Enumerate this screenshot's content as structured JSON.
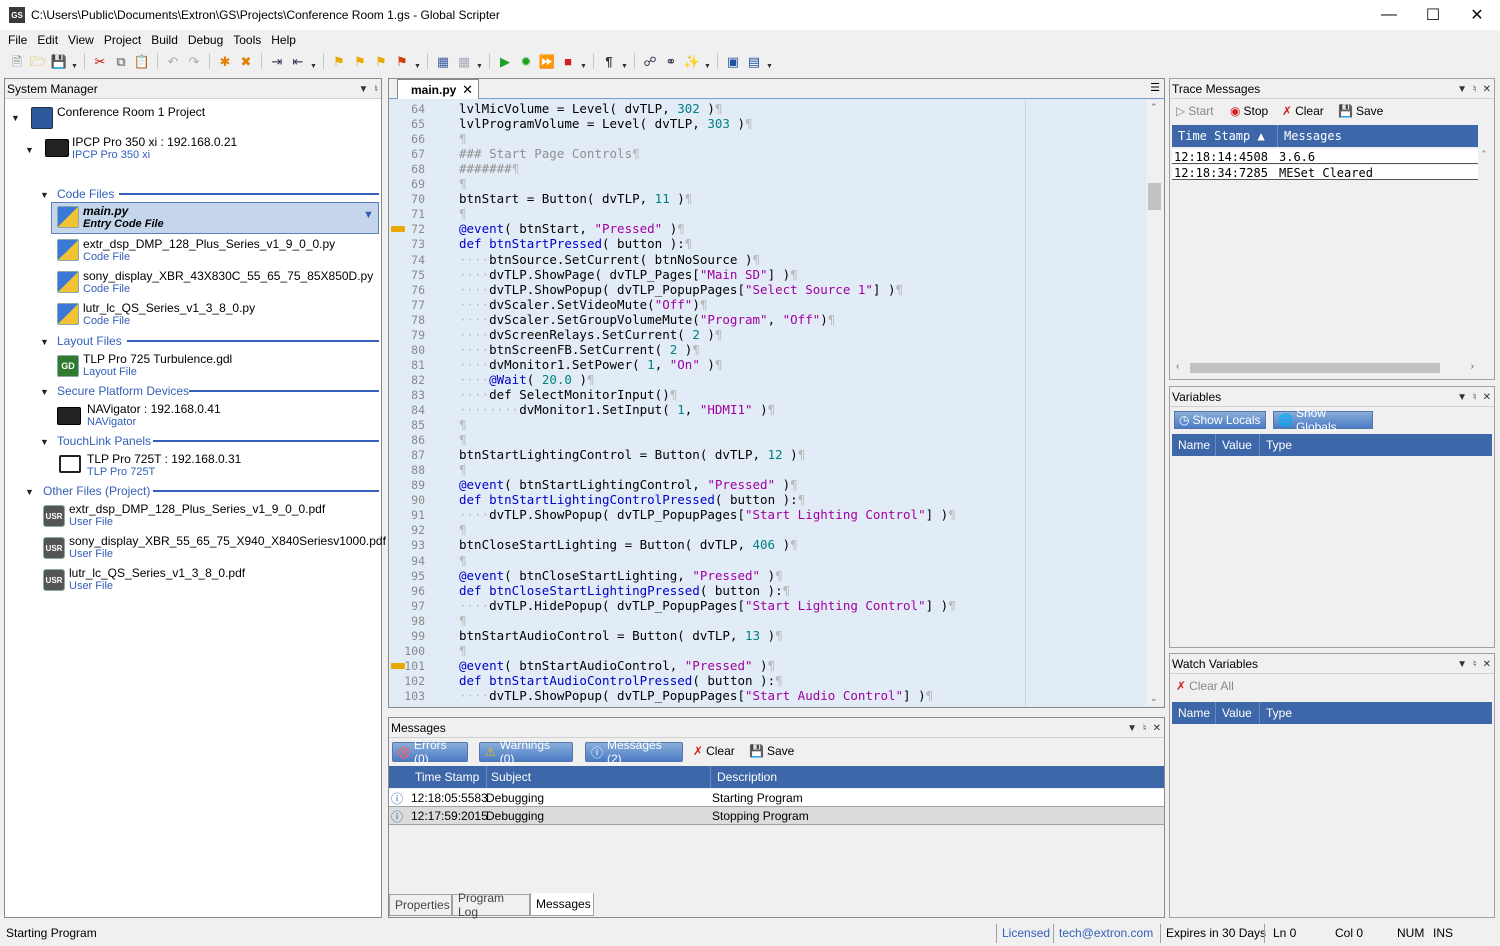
{
  "window": {
    "app_icon": "GS",
    "title": "C:\\Users\\Public\\Documents\\Extron\\GS\\Projects\\Conference Room 1.gs - Global Scripter"
  },
  "menu": [
    "File",
    "Edit",
    "View",
    "Project",
    "Build",
    "Debug",
    "Tools",
    "Help"
  ],
  "system_manager": {
    "title": "System Manager",
    "project": "Conference Room 1 Project",
    "controller": {
      "name": "IPCP Pro 350 xi : 192.168.0.21",
      "sub": "IPCP Pro 350 xi"
    },
    "sections": {
      "code_files": "Code Files",
      "layout_files": "Layout Files",
      "secure_platform": "Secure Platform Devices",
      "touchlink": "TouchLink Panels",
      "other_files": "Other Files (Project)"
    },
    "code_files": [
      {
        "name": "main.py",
        "sub": "Entry Code File"
      },
      {
        "name": "extr_dsp_DMP_128_Plus_Series_v1_9_0_0.py",
        "sub": "Code File"
      },
      {
        "name": "sony_display_XBR_43X830C_55_65_75_85X850D.py",
        "sub": "Code File"
      },
      {
        "name": "lutr_lc_QS_Series_v1_3_8_0.py",
        "sub": "Code File"
      }
    ],
    "layout_files": [
      {
        "name": "TLP Pro 725 Turbulence.gdl",
        "sub": "Layout File",
        "icon": "GD"
      }
    ],
    "secure_devices": [
      {
        "name": "NAVigator : 192.168.0.41",
        "sub": "NAVigator"
      }
    ],
    "touchlink_panels": [
      {
        "name": "TLP Pro 725T : 192.168.0.31",
        "sub": "TLP Pro 725T"
      }
    ],
    "other_files": [
      {
        "name": "extr_dsp_DMP_128_Plus_Series_v1_9_0_0.pdf",
        "sub": "User File",
        "icon": "USR"
      },
      {
        "name": "sony_display_XBR_55_65_75_X940_X840Seriesv1000.pdf",
        "sub": "User File",
        "icon": "USR"
      },
      {
        "name": "lutr_lc_QS_Series_v1_3_8_0.pdf",
        "sub": "User File",
        "icon": "USR"
      }
    ]
  },
  "editor": {
    "tab": "main.py",
    "lines": [
      {
        "n": "64",
        "t": "lvlMicVolume = Level( dvTLP, 302 )"
      },
      {
        "n": "65",
        "t": "lvlProgramVolume = Level( dvTLP, 303 )"
      },
      {
        "n": "66",
        "t": ""
      },
      {
        "n": "67",
        "t": "### Start Page Controls"
      },
      {
        "n": "68",
        "t": "#######"
      },
      {
        "n": "69",
        "t": ""
      },
      {
        "n": "70",
        "t": "btnStart = Button( dvTLP, 11 )"
      },
      {
        "n": "71",
        "t": ""
      },
      {
        "n": "72",
        "t": "@event( btnStart, \"Pressed\" )",
        "bm": true
      },
      {
        "n": "73",
        "t": "def btnStartPressed( button ):"
      },
      {
        "n": "74",
        "t": "    btnSource.SetCurrent( btnNoSource )"
      },
      {
        "n": "75",
        "t": "    dvTLP.ShowPage( dvTLP_Pages[\"Main SD\"] )"
      },
      {
        "n": "76",
        "t": "    dvTLP.ShowPopup( dvTLP_PopupPages[\"Select Source 1\"] )"
      },
      {
        "n": "77",
        "t": "    dvScaler.SetVideoMute(\"Off\")"
      },
      {
        "n": "78",
        "t": "    dvScaler.SetGroupVolumeMute(\"Program\", \"Off\")"
      },
      {
        "n": "79",
        "t": "    dvScreenRelays.SetCurrent( 2 )"
      },
      {
        "n": "80",
        "t": "    btnScreenFB.SetCurrent( 2 )"
      },
      {
        "n": "81",
        "t": "    dvMonitor1.SetPower( 1, \"On\" )"
      },
      {
        "n": "82",
        "t": "    @Wait( 20.0 )"
      },
      {
        "n": "83",
        "t": "    def SelectMonitorInput()"
      },
      {
        "n": "84",
        "t": "        dvMonitor1.SetInput( 1, \"HDMI1\" )"
      },
      {
        "n": "85",
        "t": ""
      },
      {
        "n": "86",
        "t": ""
      },
      {
        "n": "87",
        "t": "btnStartLightingControl = Button( dvTLP, 12 )"
      },
      {
        "n": "88",
        "t": ""
      },
      {
        "n": "89",
        "t": "@event( btnStartLightingControl, \"Pressed\" )"
      },
      {
        "n": "90",
        "t": "def btnStartLightingControlPressed( button ):"
      },
      {
        "n": "91",
        "t": "    dvTLP.ShowPopup( dvTLP_PopupPages[\"Start Lighting Control\"] )"
      },
      {
        "n": "92",
        "t": ""
      },
      {
        "n": "93",
        "t": "btnCloseStartLighting = Button( dvTLP, 406 )"
      },
      {
        "n": "94",
        "t": ""
      },
      {
        "n": "95",
        "t": "@event( btnCloseStartLighting, \"Pressed\" )"
      },
      {
        "n": "96",
        "t": "def btnCloseStartLightingPressed( button ):"
      },
      {
        "n": "97",
        "t": "    dvTLP.HidePopup( dvTLP_PopupPages[\"Start Lighting Control\"] )"
      },
      {
        "n": "98",
        "t": ""
      },
      {
        "n": "99",
        "t": "btnStartAudioControl = Button( dvTLP, 13 )"
      },
      {
        "n": "100",
        "t": ""
      },
      {
        "n": "101",
        "t": "@event( btnStartAudioControl, \"Pressed\" )",
        "bm": true
      },
      {
        "n": "102",
        "t": "def btnStartAudioControlPressed( button ):"
      },
      {
        "n": "103",
        "t": "    dvTLP.ShowPopup( dvTLP_PopupPages[\"Start Audio Control\"] )"
      }
    ]
  },
  "messages": {
    "title": "Messages",
    "errors": "Errors (0)",
    "warnings": "Warnings (0)",
    "messages_btn": "Messages (2)",
    "clear": "Clear",
    "save": "Save",
    "columns": [
      "Time Stamp",
      "Subject",
      "Description"
    ],
    "rows": [
      {
        "time": "12:18:05:5583",
        "subject": "Debugging",
        "desc": "Starting Program"
      },
      {
        "time": "12:17:59:2015",
        "subject": "Debugging",
        "desc": "Stopping Program"
      }
    ],
    "tabs": [
      "Properties",
      "Program Log",
      "Messages"
    ]
  },
  "trace": {
    "title": "Trace Messages",
    "start": "Start",
    "stop": "Stop",
    "clear": "Clear",
    "save": "Save",
    "columns": [
      "Time Stamp",
      "Messages"
    ],
    "rows": [
      {
        "time": "12:18:14:4508",
        "msg": "3.6.6"
      },
      {
        "time": "12:18:34:7285",
        "msg": "MESet Cleared"
      }
    ]
  },
  "variables": {
    "title": "Variables",
    "show_locals": "Show Locals",
    "show_globals": "Show Globals",
    "columns": [
      "Name",
      "Value",
      "Type"
    ]
  },
  "watch": {
    "title": "Watch Variables",
    "clear_all": "Clear All",
    "columns": [
      "Name",
      "Value",
      "Type"
    ]
  },
  "status": {
    "left": "Starting Program",
    "licensed": "Licensed",
    "email": "tech@extron.com",
    "expires": "Expires in 30 Days",
    "ln": "Ln 0",
    "col": "Col 0",
    "num": "NUM",
    "ins": "INS"
  }
}
